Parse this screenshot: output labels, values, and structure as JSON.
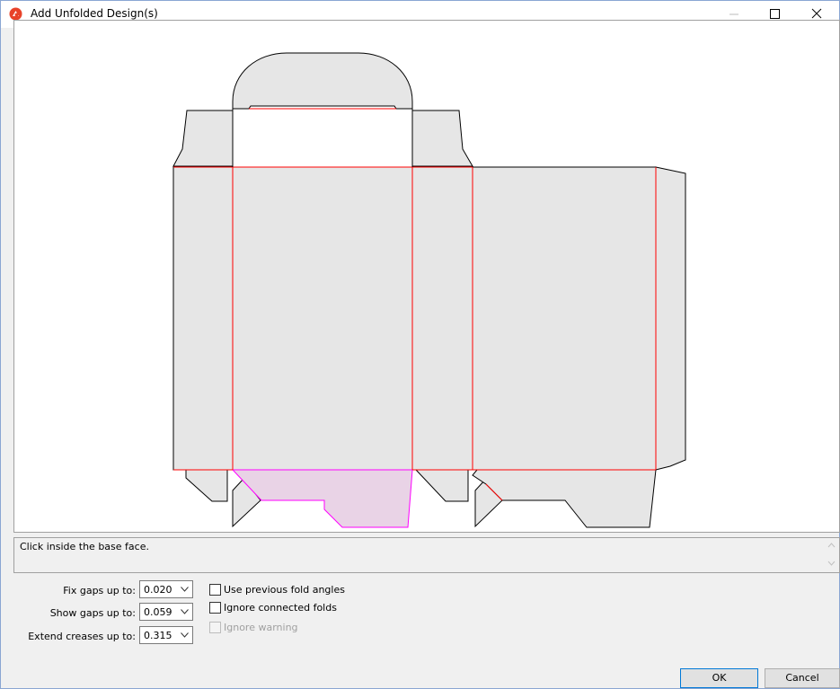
{
  "window": {
    "title": "Add Unfolded Design(s)",
    "accent": "#e8432a"
  },
  "canvas": {
    "background": "#ffffff",
    "face_fill": "#e6e6e6",
    "outline_color": "#000000",
    "crease_color": "#ff0000",
    "selected_face_fill": "#e9d3e6",
    "selected_face_stroke": "#ff00ff"
  },
  "status": {
    "message": "Click inside the base face."
  },
  "options": {
    "fix_gaps": {
      "label": "Fix gaps up to:",
      "value": "0.020"
    },
    "show_gaps": {
      "label": "Show gaps up to:",
      "value": "0.059"
    },
    "extend_creases": {
      "label": "Extend creases up to:",
      "value": "0.315"
    },
    "use_previous_fold_angles": {
      "label": "Use previous fold angles",
      "checked": false
    },
    "ignore_connected_folds": {
      "label": "Ignore connected folds",
      "checked": false
    },
    "ignore_warning": {
      "label": "Ignore warning",
      "checked": false,
      "enabled": false
    }
  },
  "buttons": {
    "ok": "OK",
    "cancel": "Cancel"
  }
}
